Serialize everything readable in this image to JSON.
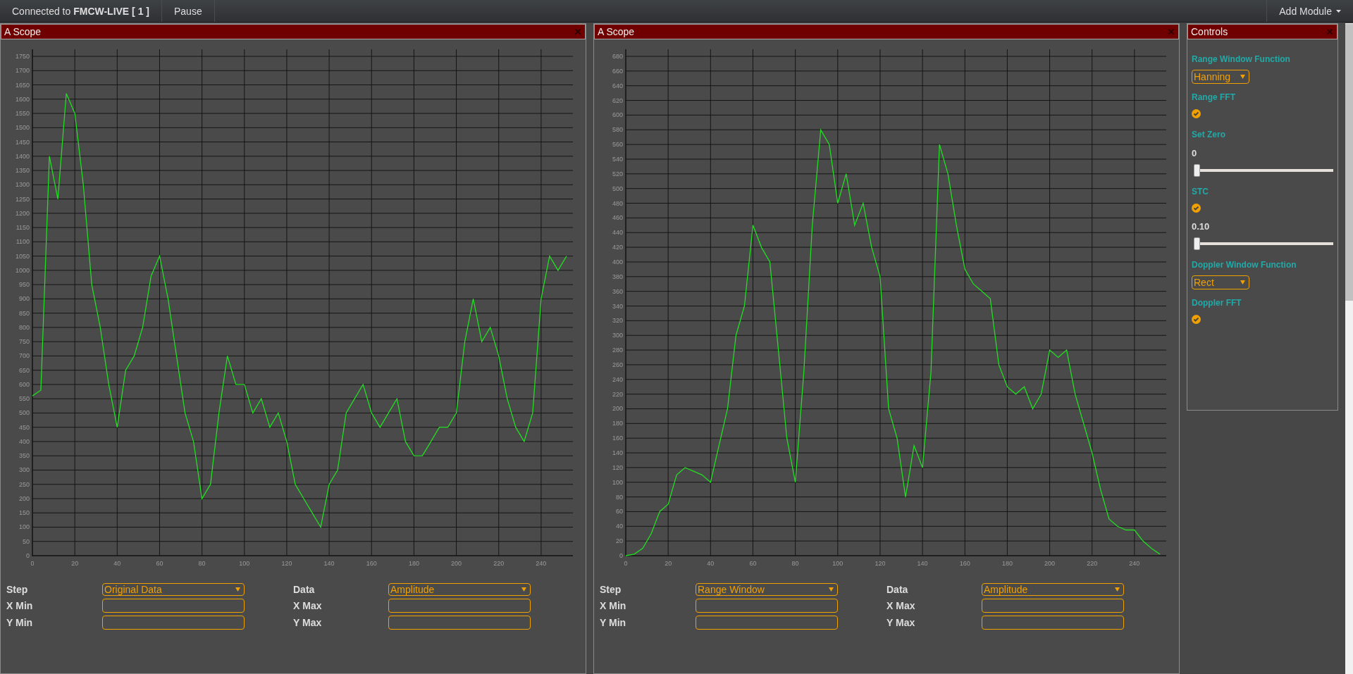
{
  "top_bar": {
    "connection": "Connected to **FMCW-LIVE [ 1 ]**",
    "pause": "Pause",
    "add_module": "Add Module"
  },
  "scopes": [
    {
      "title": "A Scope",
      "chart_data": {
        "type": "line",
        "x": [
          0,
          4,
          8,
          12,
          16,
          20,
          24,
          28,
          32,
          36,
          40,
          44,
          48,
          52,
          56,
          60,
          64,
          68,
          72,
          76,
          80,
          84,
          88,
          92,
          96,
          100,
          104,
          108,
          112,
          116,
          120,
          124,
          128,
          132,
          136,
          140,
          144,
          148,
          152,
          156,
          160,
          164,
          168,
          172,
          176,
          180,
          184,
          188,
          192,
          196,
          200,
          204,
          208,
          212,
          216,
          220,
          224,
          228,
          232,
          236,
          240,
          244,
          248,
          252
        ],
        "grid": true,
        "series": [
          {
            "color": "#22dd22",
            "values": [
              560,
              580,
              1400,
              1250,
              1620,
              1550,
              1300,
              950,
              800,
              600,
              450,
              650,
              700,
              800,
              980,
              1050,
              900,
              700,
              500,
              400,
              200,
              250,
              500,
              700,
              600,
              600,
              500,
              550,
              450,
              500,
              400,
              250,
              200,
              150,
              100,
              250,
              300,
              500,
              550,
              600,
              500,
              450,
              500,
              550,
              400,
              350,
              350,
              400,
              450,
              450,
              500,
              750,
              900,
              750,
              800,
              700,
              550,
              450,
              400,
              500,
              900,
              1050,
              1000,
              1050
            ]
          }
        ],
        "xlim": [
          0,
          255
        ],
        "ylim": [
          0,
          1750
        ],
        "xticks": [
          0,
          20,
          40,
          60,
          80,
          100,
          120,
          140,
          160,
          180,
          200,
          220,
          240
        ],
        "yticks": [
          0,
          50,
          100,
          150,
          200,
          250,
          300,
          350,
          400,
          450,
          500,
          550,
          600,
          650,
          700,
          750,
          800,
          850,
          900,
          950,
          1000,
          1050,
          1100,
          1150,
          1200,
          1250,
          1300,
          1350,
          1400,
          1450,
          1500,
          1550,
          1600,
          1650,
          1700,
          1750
        ]
      },
      "form": [
        {
          "kind": "select",
          "label": "Step",
          "value": "Original Data"
        },
        {
          "kind": "select",
          "label": "Data",
          "value": "Amplitude"
        },
        {
          "kind": "input",
          "label": "X Min"
        },
        {
          "kind": "input",
          "label": "X Max"
        },
        {
          "kind": "input",
          "label": "Y Min"
        },
        {
          "kind": "input",
          "label": "Y Max"
        }
      ]
    },
    {
      "title": "A Scope",
      "chart_data": {
        "type": "line",
        "x": [
          0,
          4,
          8,
          12,
          16,
          20,
          24,
          28,
          32,
          36,
          40,
          44,
          48,
          52,
          56,
          60,
          64,
          68,
          72,
          76,
          80,
          84,
          88,
          92,
          96,
          100,
          104,
          108,
          112,
          116,
          120,
          124,
          128,
          132,
          136,
          140,
          144,
          148,
          152,
          156,
          160,
          164,
          168,
          172,
          176,
          180,
          184,
          188,
          192,
          196,
          200,
          204,
          208,
          212,
          216,
          220,
          224,
          228,
          232,
          236,
          240,
          244,
          248,
          252
        ],
        "grid": true,
        "series": [
          {
            "color": "#22dd22",
            "values": [
              0,
              2,
              10,
              30,
              60,
              70,
              110,
              120,
              115,
              110,
              100,
              150,
              200,
              300,
              340,
              450,
              420,
              400,
              280,
              160,
              100,
              250,
              450,
              580,
              560,
              480,
              520,
              450,
              480,
              420,
              380,
              200,
              160,
              80,
              150,
              120,
              250,
              560,
              520,
              450,
              390,
              370,
              360,
              350,
              260,
              230,
              220,
              230,
              200,
              220,
              280,
              270,
              280,
              220,
              180,
              140,
              90,
              50,
              40,
              35,
              35,
              20,
              10,
              2
            ]
          }
        ],
        "xlim": [
          0,
          255
        ],
        "ylim": [
          0,
          680
        ],
        "xticks": [
          0,
          20,
          40,
          60,
          80,
          100,
          120,
          140,
          160,
          180,
          200,
          220,
          240
        ],
        "yticks": [
          0,
          20,
          40,
          60,
          80,
          100,
          120,
          140,
          160,
          180,
          200,
          220,
          240,
          260,
          280,
          300,
          320,
          340,
          360,
          380,
          400,
          420,
          440,
          460,
          480,
          500,
          520,
          540,
          560,
          580,
          600,
          620,
          640,
          660,
          680
        ]
      },
      "form": [
        {
          "kind": "select",
          "label": "Step",
          "value": "Range Window"
        },
        {
          "kind": "select",
          "label": "Data",
          "value": "Amplitude"
        },
        {
          "kind": "input",
          "label": "X Min"
        },
        {
          "kind": "input",
          "label": "X Max"
        },
        {
          "kind": "input",
          "label": "Y Min"
        },
        {
          "kind": "input",
          "label": "Y Max"
        }
      ]
    }
  ],
  "controls": {
    "title": "Controls",
    "items": [
      {
        "kind": "select",
        "label": "Range Window Function",
        "value": "Hanning"
      },
      {
        "kind": "checkbox",
        "label": "Range FFT",
        "checked": true
      },
      {
        "kind": "slider",
        "label": "Set Zero",
        "reading": "0",
        "level": 0
      },
      {
        "kind": "checkbox",
        "label": "STC",
        "checked": true
      },
      {
        "kind": "slider",
        "reading": "0.10",
        "level": 0
      },
      {
        "kind": "select",
        "label": "Doppler Window Function",
        "value": "Rect"
      },
      {
        "kind": "checkbox",
        "label": "Doppler FFT",
        "checked": true
      }
    ]
  }
}
